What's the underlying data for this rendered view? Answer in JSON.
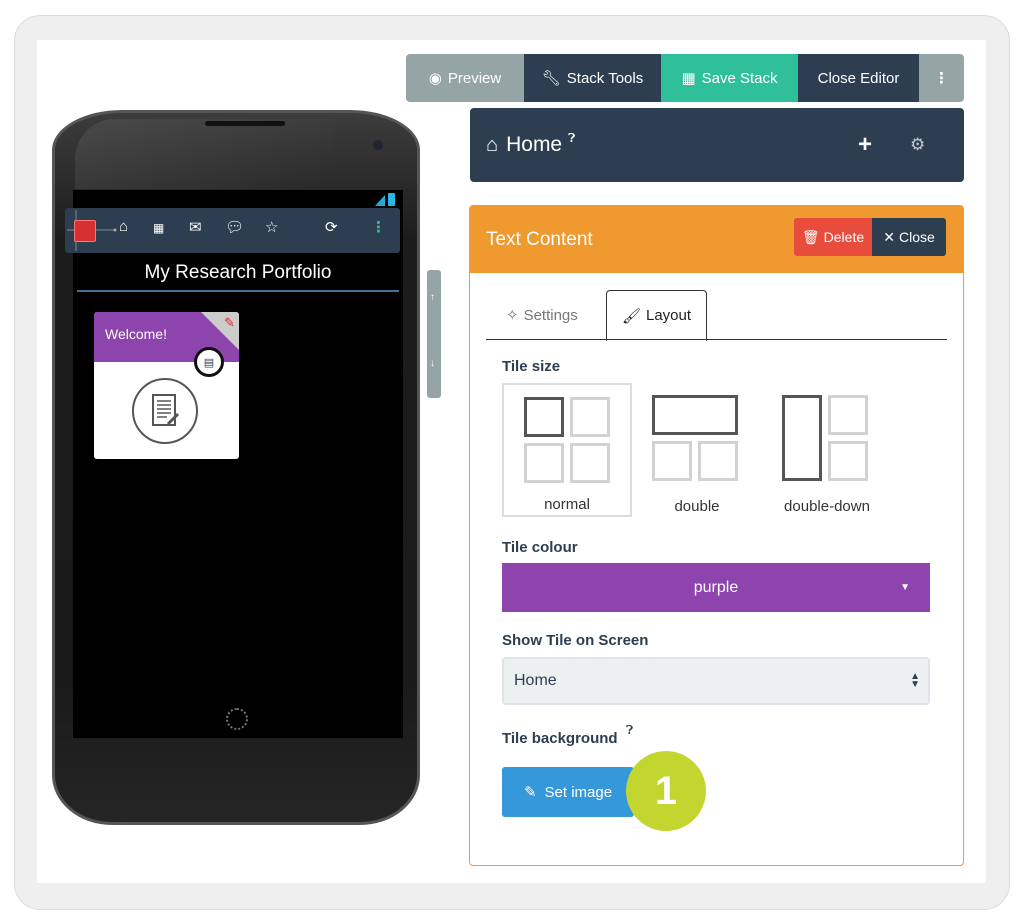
{
  "toolbar": {
    "preview_label": "Preview",
    "stack_tools_label": "Stack Tools",
    "save_stack_label": "Save Stack",
    "close_editor_label": "Close Editor",
    "more_label": "⋮"
  },
  "screen_header": {
    "title": "Home",
    "help": "?",
    "add": "+",
    "settings": "⚙"
  },
  "panel": {
    "title": "Text Content",
    "delete_label": "Delete",
    "close_label": "Close",
    "tabs": [
      {
        "label": "Settings",
        "active": false
      },
      {
        "label": "Layout",
        "active": true
      }
    ],
    "tile_size": {
      "label": "Tile size",
      "options": [
        {
          "label": "normal",
          "selected": true
        },
        {
          "label": "double",
          "selected": false
        },
        {
          "label": "double-down",
          "selected": false
        }
      ]
    },
    "tile_colour": {
      "label": "Tile colour",
      "value": "purple",
      "swatch": "#8e44ad"
    },
    "show_on_screen": {
      "label": "Show Tile on Screen",
      "value": "Home"
    },
    "tile_background": {
      "label": "Tile background",
      "help": "?",
      "button_label": "Set image"
    },
    "callout_number": "1"
  },
  "phone": {
    "app_title": "My Research Portfolio",
    "toolbar_icons": [
      "home-icon",
      "qrcode-icon",
      "envelope-icon",
      "comments-icon",
      "star-icon",
      "refresh-icon",
      "more-icon"
    ],
    "tile": {
      "title": "Welcome!",
      "colour": "#8e44ad"
    }
  },
  "scroll": {
    "up": "↑",
    "down": "↓"
  },
  "colors": {
    "dark": "#2c3e50",
    "grey": "#95a5a6",
    "green": "#2fbf9b",
    "orange": "#f0992e",
    "red": "#e74c3c",
    "blue": "#3498db",
    "purple": "#8e44ad",
    "callout": "#c2d62f"
  }
}
